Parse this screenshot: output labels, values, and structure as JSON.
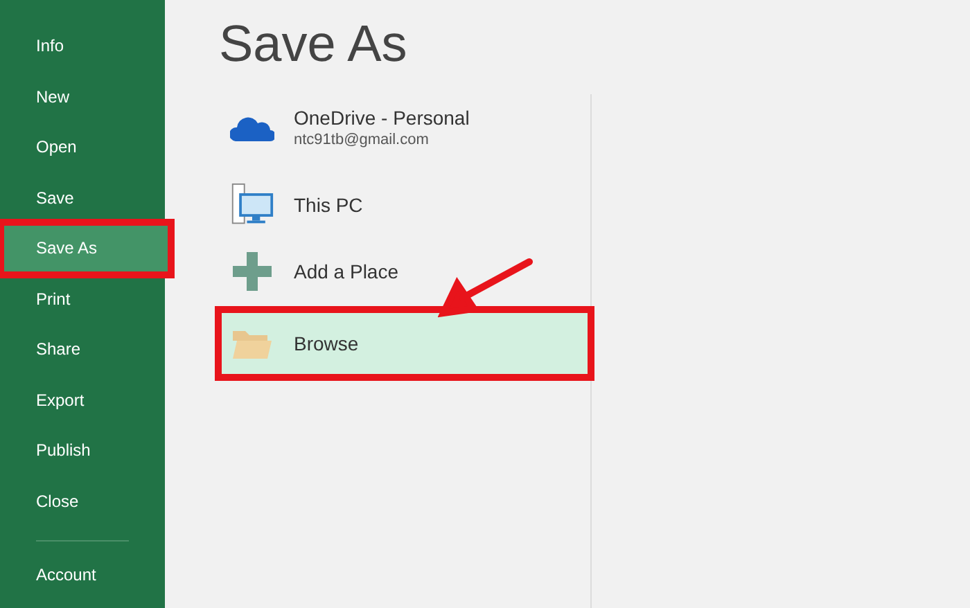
{
  "sidebar": {
    "items": [
      {
        "label": "Info",
        "selected": false,
        "highlighted": false
      },
      {
        "label": "New",
        "selected": false,
        "highlighted": false
      },
      {
        "label": "Open",
        "selected": false,
        "highlighted": false
      },
      {
        "label": "Save",
        "selected": false,
        "highlighted": false
      },
      {
        "label": "Save As",
        "selected": true,
        "highlighted": true
      },
      {
        "label": "Print",
        "selected": false,
        "highlighted": false
      },
      {
        "label": "Share",
        "selected": false,
        "highlighted": false
      },
      {
        "label": "Export",
        "selected": false,
        "highlighted": false
      },
      {
        "label": "Publish",
        "selected": false,
        "highlighted": false
      },
      {
        "label": "Close",
        "selected": false,
        "highlighted": false
      }
    ],
    "footer_items": [
      {
        "label": "Account",
        "selected": false,
        "highlighted": false
      }
    ]
  },
  "title": "Save As",
  "places": [
    {
      "kind": "cloud",
      "title": "OneDrive - Personal",
      "subtitle": "ntc91tb@gmail.com",
      "selected": false,
      "highlighted": false
    },
    {
      "kind": "pc",
      "title": "This PC",
      "selected": false,
      "highlighted": false
    },
    {
      "kind": "add",
      "title": "Add a Place",
      "selected": false,
      "highlighted": false
    },
    {
      "kind": "folder",
      "title": "Browse",
      "selected": true,
      "highlighted": true
    }
  ],
  "annotation_arrow": true
}
